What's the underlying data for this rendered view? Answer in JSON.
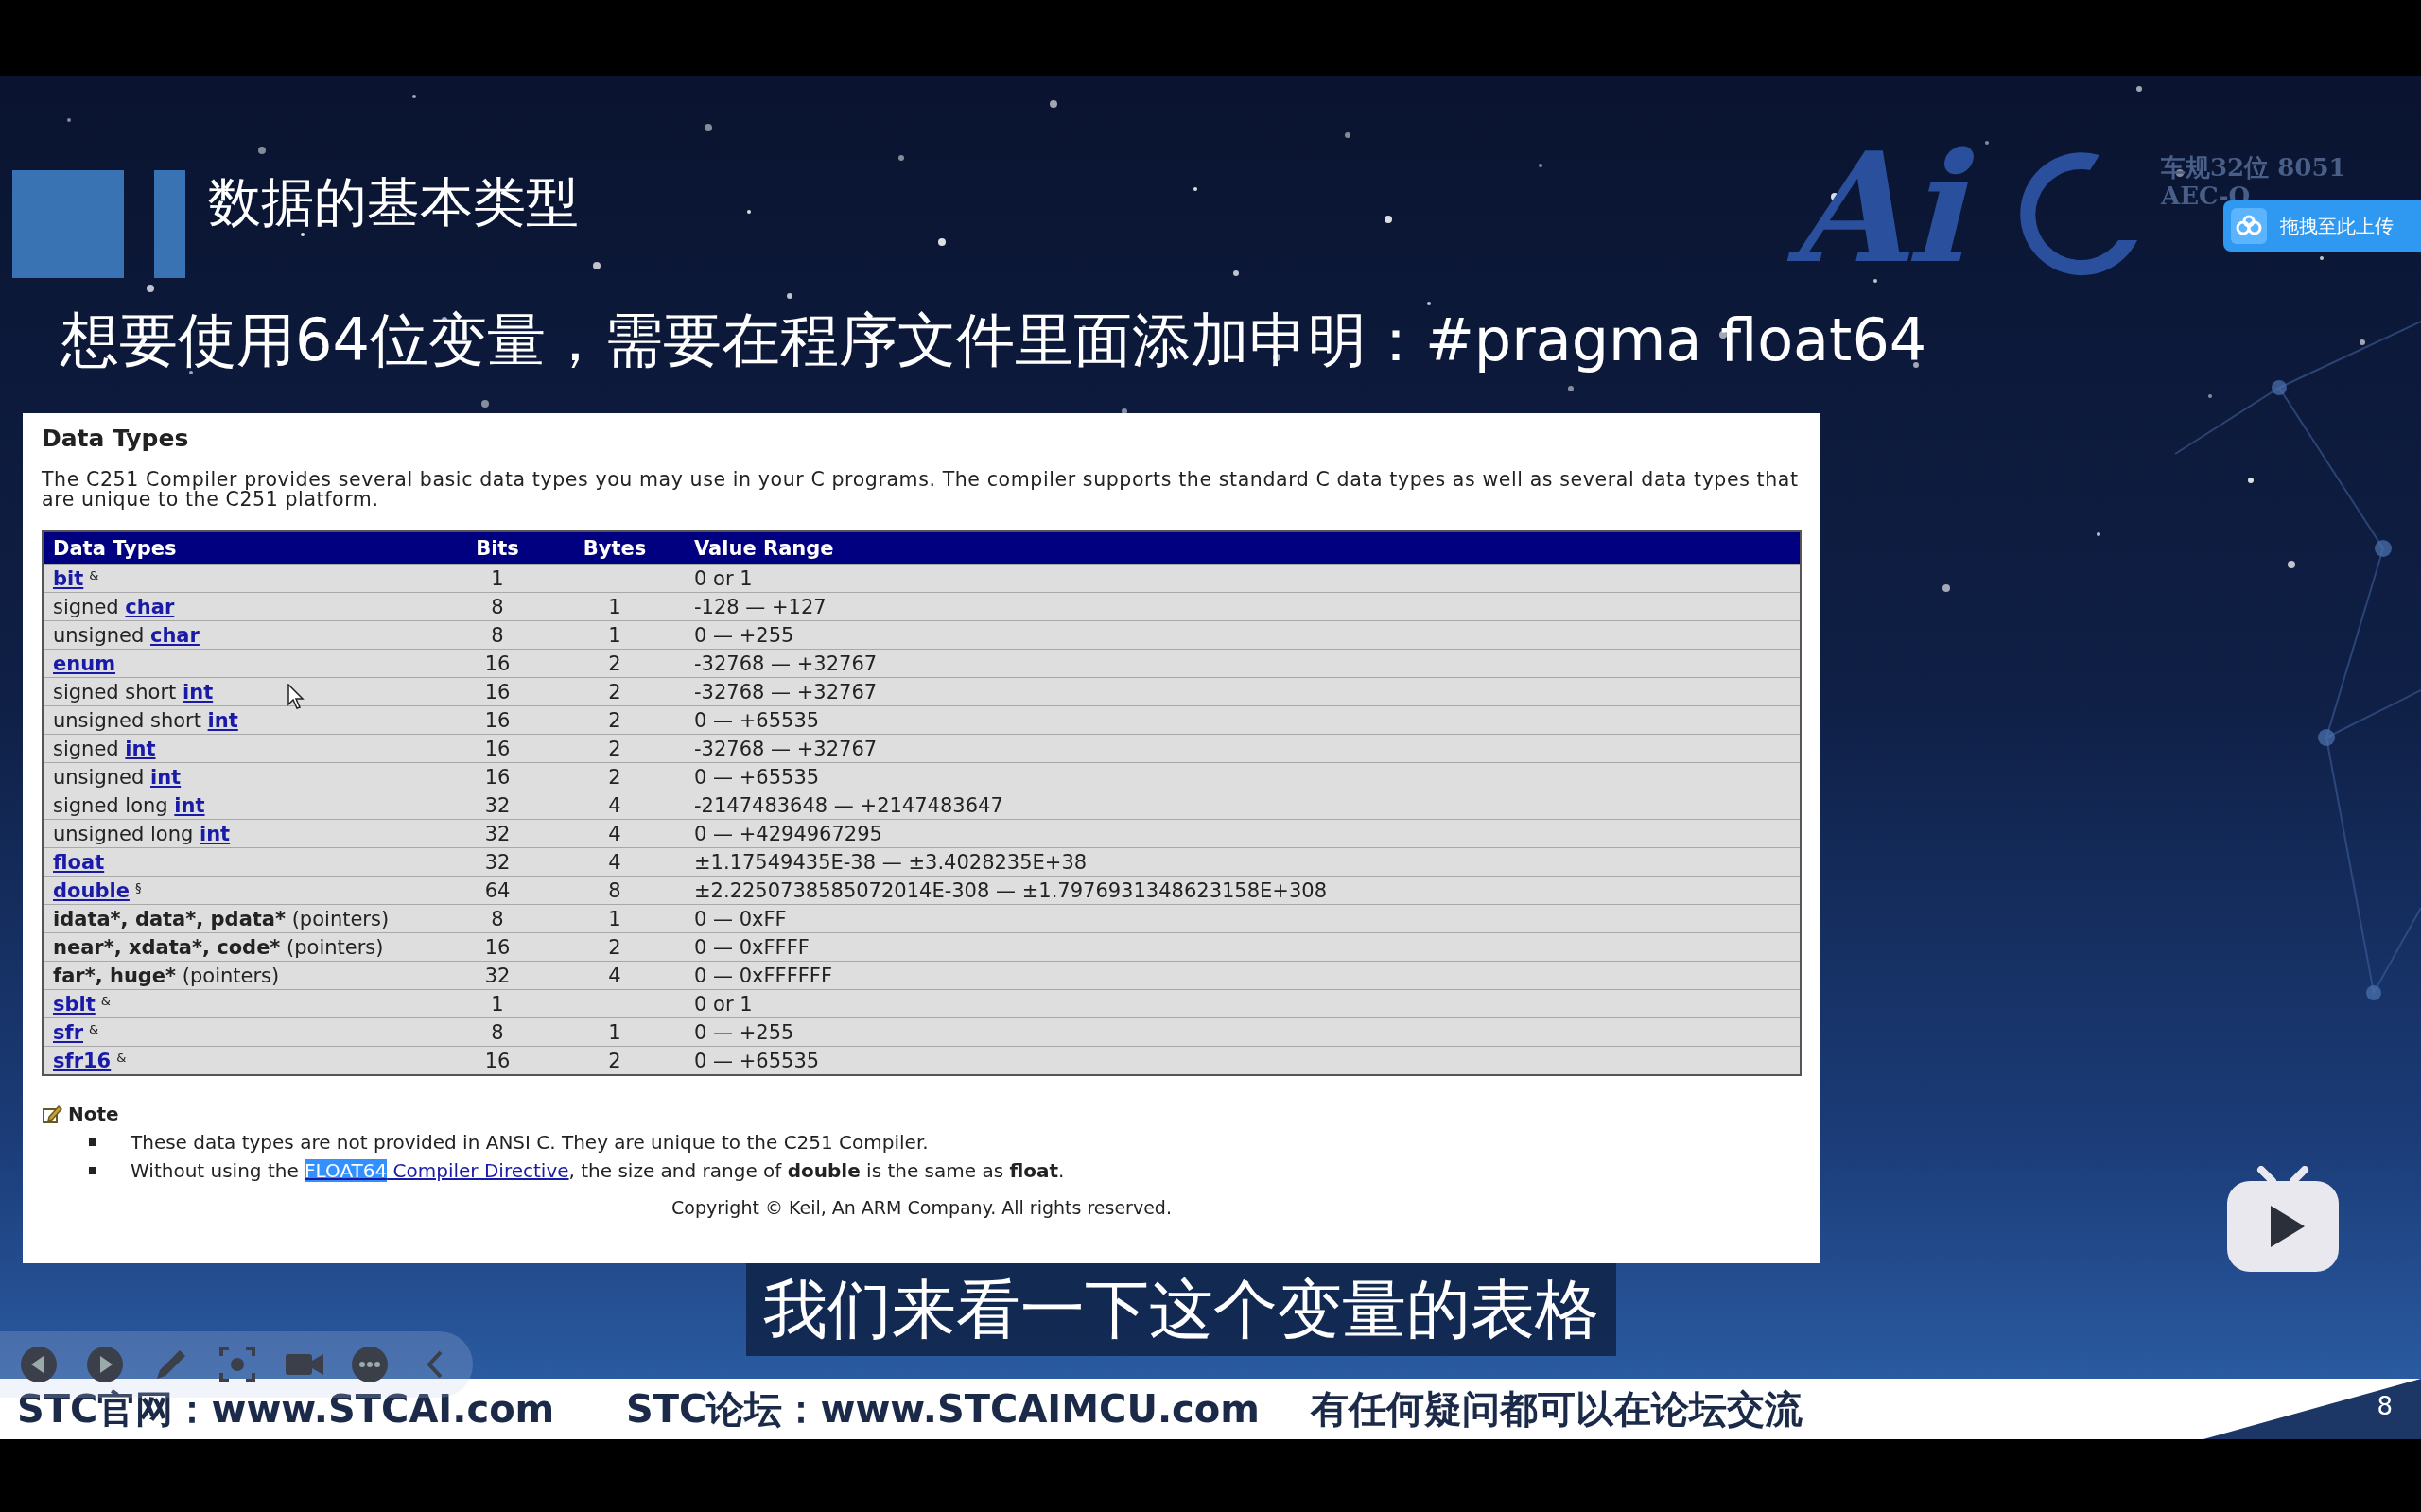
{
  "header": {
    "title": "数据的基本类型",
    "subtitle": "想要使用64位变量，需要在程序文件里面添加申明：#pragma float64",
    "logo": {
      "mark": "Ai",
      "line_1": "车规32位 8051",
      "line_2": "AEC-Q"
    }
  },
  "upload_button": {
    "label": "拖拽至此上传"
  },
  "doc": {
    "heading": "Data Types",
    "intro": "The C251 Compiler provides several basic data types you may use in your C programs. The compiler supports the standard C data types as well as several data types that are unique to the C251 platform.",
    "table": {
      "columns": [
        "Data Types",
        "Bits",
        "Bytes",
        "Value Range"
      ],
      "rows": [
        {
          "type": [
            {
              "kind": "link",
              "text": "bit"
            },
            {
              "kind": "sup",
              "text": "&"
            }
          ],
          "bits": "1",
          "range": "0 or 1"
        },
        {
          "type": [
            {
              "kind": "plain",
              "text": "signed "
            },
            {
              "kind": "link",
              "text": "char"
            }
          ],
          "bits": "8",
          "bytes": "1",
          "range": "-128 — +127"
        },
        {
          "type": [
            {
              "kind": "plain",
              "text": "unsigned "
            },
            {
              "kind": "link",
              "text": "char"
            }
          ],
          "bits": "8",
          "bytes": "1",
          "range": "0 — +255"
        },
        {
          "type": [
            {
              "kind": "link",
              "text": "enum"
            }
          ],
          "bits": "16",
          "bytes": "2",
          "range": "-32768 — +32767"
        },
        {
          "type": [
            {
              "kind": "plain",
              "text": "signed short "
            },
            {
              "kind": "link",
              "text": "int"
            }
          ],
          "bits": "16",
          "bytes": "2",
          "range": "-32768 — +32767"
        },
        {
          "type": [
            {
              "kind": "plain",
              "text": "unsigned short "
            },
            {
              "kind": "link",
              "text": "int"
            }
          ],
          "bits": "16",
          "bytes": "2",
          "range": "0 — +65535"
        },
        {
          "type": [
            {
              "kind": "plain",
              "text": "signed "
            },
            {
              "kind": "link",
              "text": "int"
            }
          ],
          "bits": "16",
          "bytes": "2",
          "range": "-32768 — +32767"
        },
        {
          "type": [
            {
              "kind": "plain",
              "text": "unsigned "
            },
            {
              "kind": "link",
              "text": "int"
            }
          ],
          "bits": "16",
          "bytes": "2",
          "range": "0 — +65535"
        },
        {
          "type": [
            {
              "kind": "plain",
              "text": "signed long "
            },
            {
              "kind": "link",
              "text": "int"
            }
          ],
          "bits": "32",
          "bytes": "4",
          "range": "-2147483648 — +2147483647"
        },
        {
          "type": [
            {
              "kind": "plain",
              "text": "unsigned long "
            },
            {
              "kind": "link",
              "text": "int"
            }
          ],
          "bits": "32",
          "bytes": "4",
          "range": "0 — +4294967295"
        },
        {
          "type": [
            {
              "kind": "link",
              "text": "float"
            }
          ],
          "bits": "32",
          "bytes": "4",
          "range": "±1.17549435E-38 — ±3.4028235E+38"
        },
        {
          "type": [
            {
              "kind": "link",
              "text": "double"
            },
            {
              "kind": "sup",
              "text": "§"
            }
          ],
          "bits": "64",
          "bytes": "8",
          "range": "±2.2250738585072014E-308 — ±1.7976931348623158E+308"
        },
        {
          "type": [
            {
              "kind": "bold",
              "text": "idata*, data*, pdata*"
            },
            {
              "kind": "plain",
              "text": " (pointers)"
            }
          ],
          "bits": "8",
          "bytes": "1",
          "range": "0 — 0xFF"
        },
        {
          "type": [
            {
              "kind": "bold",
              "text": "near*, xdata*, code*"
            },
            {
              "kind": "plain",
              "text": " (pointers)"
            }
          ],
          "bits": "16",
          "bytes": "2",
          "range": "0 — 0xFFFF"
        },
        {
          "type": [
            {
              "kind": "bold",
              "text": "far*, huge*"
            },
            {
              "kind": "plain",
              "text": " (pointers)"
            }
          ],
          "bits": "32",
          "bytes": "4",
          "range": "0 — 0xFFFFFF"
        },
        {
          "type": [
            {
              "kind": "link",
              "text": "sbit"
            },
            {
              "kind": "sup",
              "text": "&"
            }
          ],
          "bits": "1",
          "range": "0 or 1"
        },
        {
          "type": [
            {
              "kind": "link",
              "text": "sfr"
            },
            {
              "kind": "sup",
              "text": "&"
            }
          ],
          "bits": "8",
          "bytes": "1",
          "range": "0 — +255"
        },
        {
          "type": [
            {
              "kind": "link",
              "text": "sfr16"
            },
            {
              "kind": "sup",
              "text": "&"
            }
          ],
          "bits": "16",
          "bytes": "2",
          "range": "0 — +65535"
        }
      ]
    },
    "note": {
      "title": "Note",
      "items": [
        [
          {
            "kind": "plain",
            "text": "These data types are not provided in ANSI C. They are unique to the C251 Compiler."
          }
        ],
        [
          {
            "kind": "plain",
            "text": "Without using the "
          },
          {
            "kind": "link",
            "parts": [
              {
                "text": "FLOAT64",
                "selected": true
              },
              {
                "text": " Compiler Directive",
                "selected": false
              }
            ]
          },
          {
            "kind": "plain",
            "text": ", the size and range of "
          },
          {
            "kind": "bold",
            "text": "double"
          },
          {
            "kind": "plain",
            "text": " is the same as "
          },
          {
            "kind": "bold",
            "text": "float"
          },
          {
            "kind": "plain",
            "text": "."
          }
        ]
      ]
    },
    "copyright": "Copyright © Keil, An ARM Company. All rights reserved."
  },
  "caption": "我们来看一下这个变量的表格",
  "footer": {
    "items": [
      "STC官网：www.STCAI.com",
      "STC论坛：www.STCAIMCU.com",
      "有任何疑问都可以在论坛交流"
    ],
    "page": "8"
  }
}
